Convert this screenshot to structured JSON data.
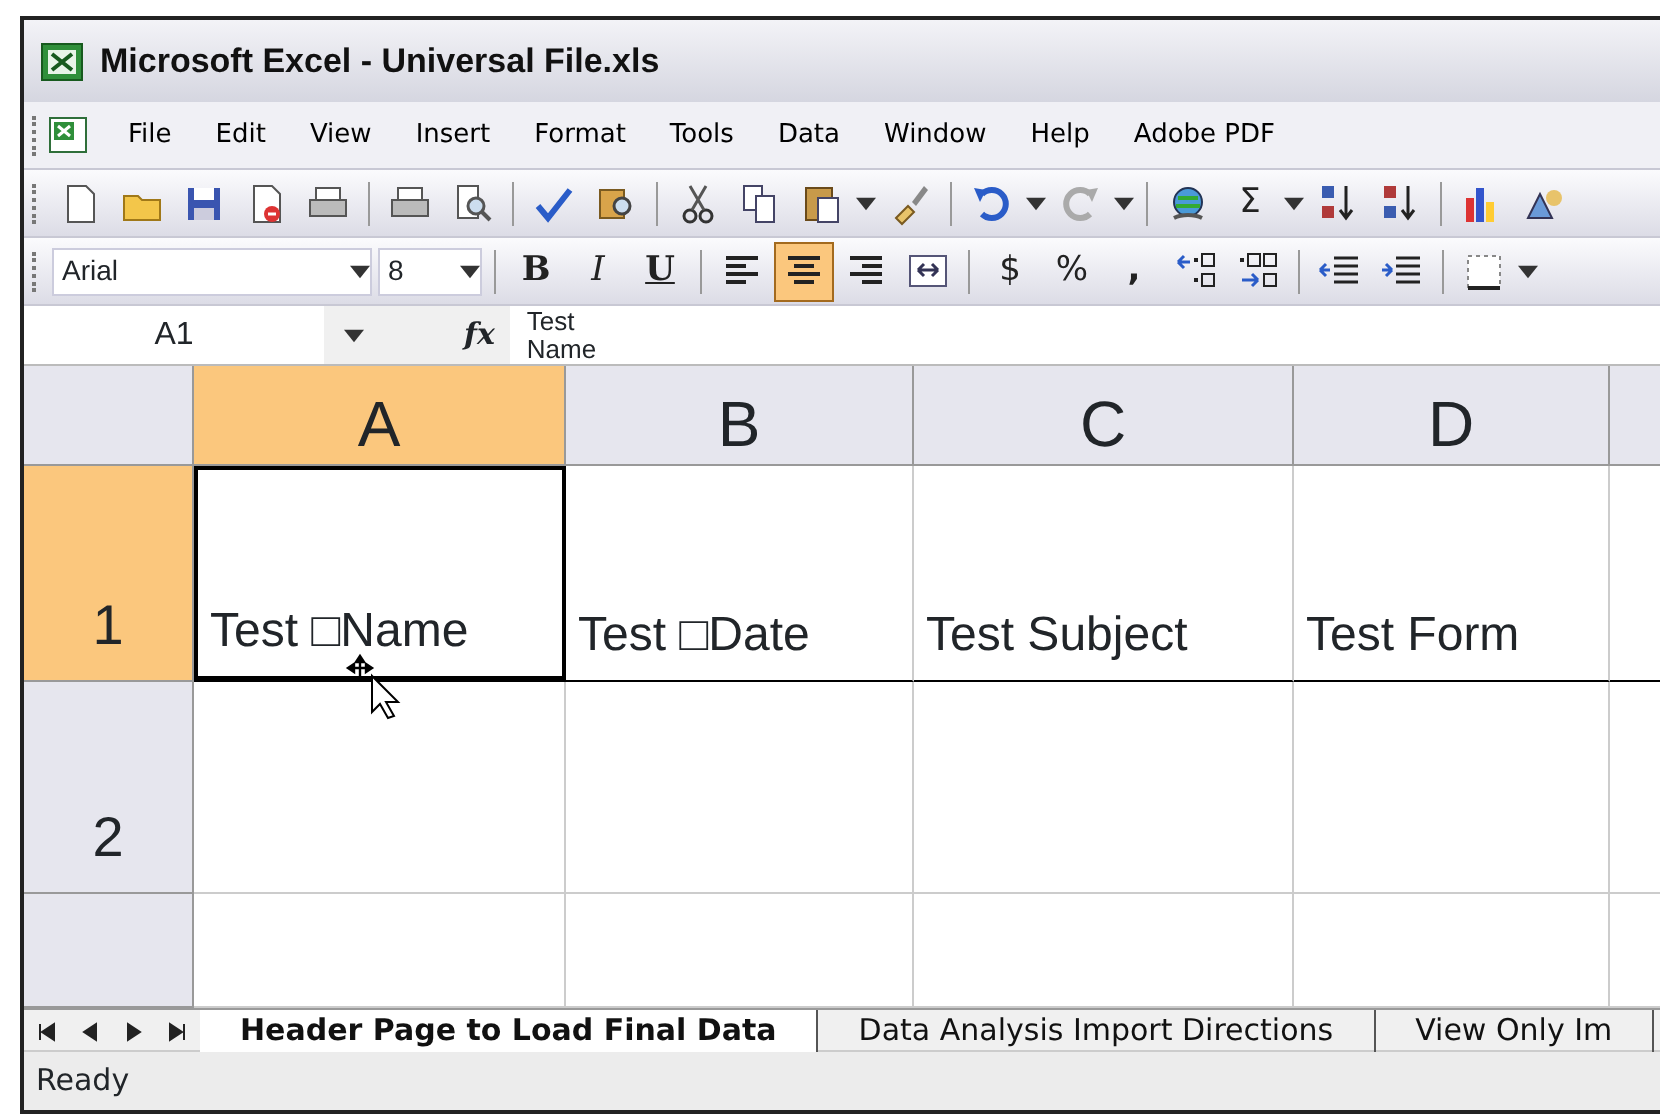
{
  "window": {
    "title": "Microsoft Excel - Universal File.xls"
  },
  "menu": [
    "File",
    "Edit",
    "View",
    "Insert",
    "Format",
    "Tools",
    "Data",
    "Window",
    "Help",
    "Adobe PDF"
  ],
  "standard_toolbar": {
    "sum_label": "Σ"
  },
  "formatting_toolbar": {
    "font": "Arial",
    "size": "8",
    "bold": "B",
    "italic": "I",
    "underline": "U",
    "alignment": [
      {
        "selected": false
      },
      {
        "selected": true
      },
      {
        "selected": false
      }
    ],
    "currency": "$",
    "percent": "%",
    "comma": ","
  },
  "formula_bar": {
    "name_box": "A1",
    "fx": "fx",
    "value_lines": [
      "Test",
      "Name"
    ]
  },
  "sheet": {
    "columns": [
      {
        "label": "A",
        "selected": true
      },
      {
        "label": "B",
        "selected": false
      },
      {
        "label": "C",
        "selected": false
      },
      {
        "label": "D",
        "selected": false
      }
    ],
    "rows": [
      {
        "label": "1",
        "selected": true,
        "cells": [
          {
            "text": "Test □Name",
            "active": true
          },
          {
            "text": "Test □Date",
            "active": false
          },
          {
            "text": "Test Subject",
            "active": false
          },
          {
            "text": "Test Form",
            "active": false
          }
        ]
      },
      {
        "label": "2",
        "selected": false,
        "cells": []
      }
    ]
  },
  "sheet_tabs": [
    {
      "label": "Header Page to Load Final Data",
      "selected": true
    },
    {
      "label": "Data Analysis Import Directions",
      "selected": false
    },
    {
      "label": "View Only Im",
      "selected": false
    }
  ],
  "status_bar": {
    "text": "Ready"
  }
}
